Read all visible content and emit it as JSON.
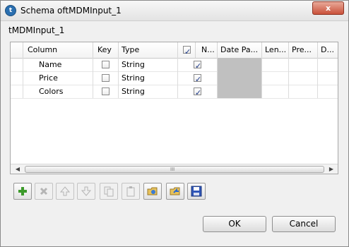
{
  "window": {
    "title": "Schema oftMDMInput_1",
    "close_label": "x",
    "app_icon_letter": "t"
  },
  "schema_label": "tMDMInput_1",
  "table": {
    "columns": [
      "Column",
      "Key",
      "Type",
      "",
      "N...",
      "Date Pa...",
      "Len...",
      "Pre...",
      "D..."
    ],
    "header_checkbox_checked": true,
    "rows": [
      {
        "column": "Name",
        "key": false,
        "type": "String",
        "nullable": true
      },
      {
        "column": "Price",
        "key": false,
        "type": "String",
        "nullable": true
      },
      {
        "column": "Colors",
        "key": false,
        "type": "String",
        "nullable": true
      }
    ],
    "scrollbar_grip": "III"
  },
  "toolbar": {
    "icons": [
      "add-icon",
      "remove-icon",
      "move-up-icon",
      "move-down-icon",
      "copy-icon",
      "paste-icon",
      "import-icon",
      "export-icon",
      "save-icon"
    ]
  },
  "buttons": {
    "ok": "OK",
    "cancel": "Cancel"
  }
}
